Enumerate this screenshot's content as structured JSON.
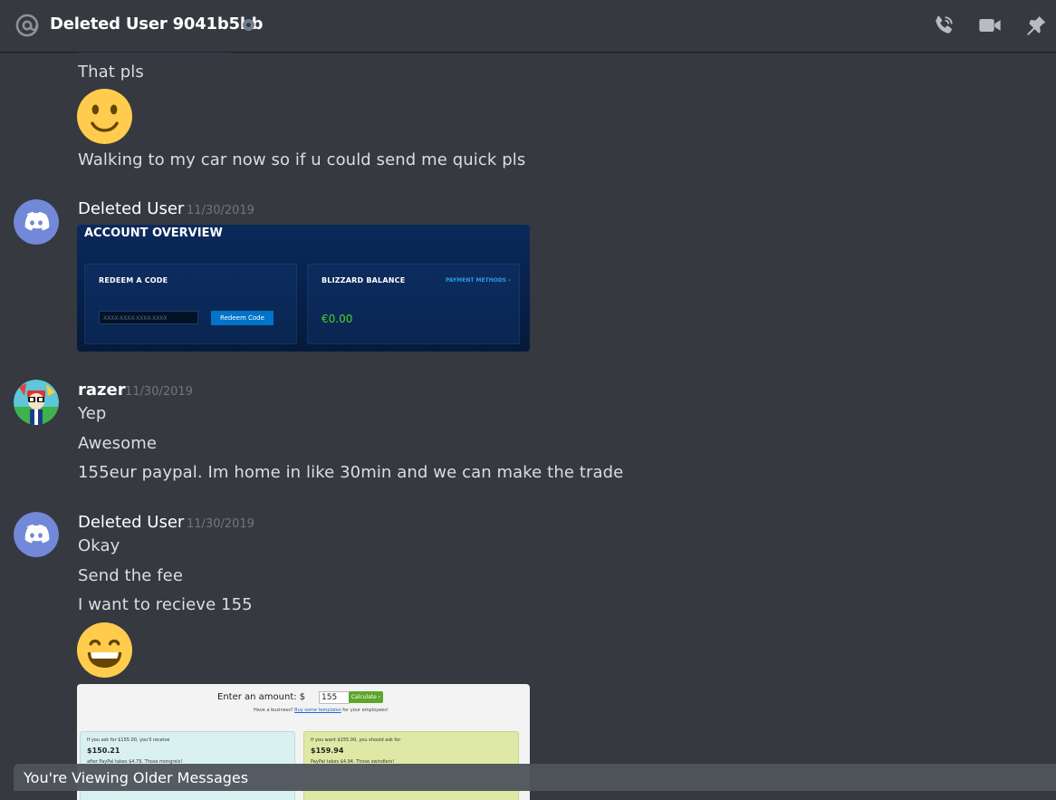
{
  "header": {
    "title": "Deleted User 9041b5bb",
    "at_icon": "at-icon",
    "status_icon": "offline-status-icon",
    "actions": [
      {
        "name": "start-voice-call-icon"
      },
      {
        "name": "start-video-call-icon"
      },
      {
        "name": "pinned-messages-icon"
      }
    ]
  },
  "messages": {
    "m1": "That pls",
    "m2": "Walking to my car now so if u could send me quick pls",
    "group2": {
      "username": "Deleted User",
      "timestamp": "11/30/2019"
    },
    "blizzard": {
      "title": "ACCOUNT OVERVIEW",
      "redeem_label": "REDEEM A CODE",
      "code_placeholder": "XXXX-XXXX-XXXX-XXXX",
      "redeem_button": "Redeem Code",
      "balance_label": "BLIZZARD BALANCE",
      "payment_link": "PAYMENT METHODS ›",
      "balance_value": "€0.00"
    },
    "group3": {
      "username": "razer",
      "timestamp": "11/30/2019",
      "lines": [
        "Yep",
        "Awesome",
        "155eur paypal. Im home in like 30min and we can make the trade"
      ]
    },
    "group4": {
      "username": "Deleted User",
      "timestamp": "11/30/2019",
      "lines": [
        "Okay",
        "Send the fee",
        "I want to recieve 155"
      ]
    },
    "paypal": {
      "enter_label": "Enter an amount: $",
      "amount": "155",
      "calc_button": "Calculate ›",
      "note_pre": "Have a business?",
      "note_link": "Buy some templates",
      "note_post": "for your employees!",
      "left_line1": "If you ask for $155.00, you'll receive",
      "left_amount": "$150.21",
      "left_line2": "after PayPal takes $4.79. Those mongrels!",
      "right_line1": "If you want $155.00, you should ask for",
      "right_amount": "$159.94",
      "right_line2": "PayPal takes $4.94. Those swindlers!"
    }
  },
  "older_bar": {
    "text": "You're Viewing Older Messages"
  }
}
